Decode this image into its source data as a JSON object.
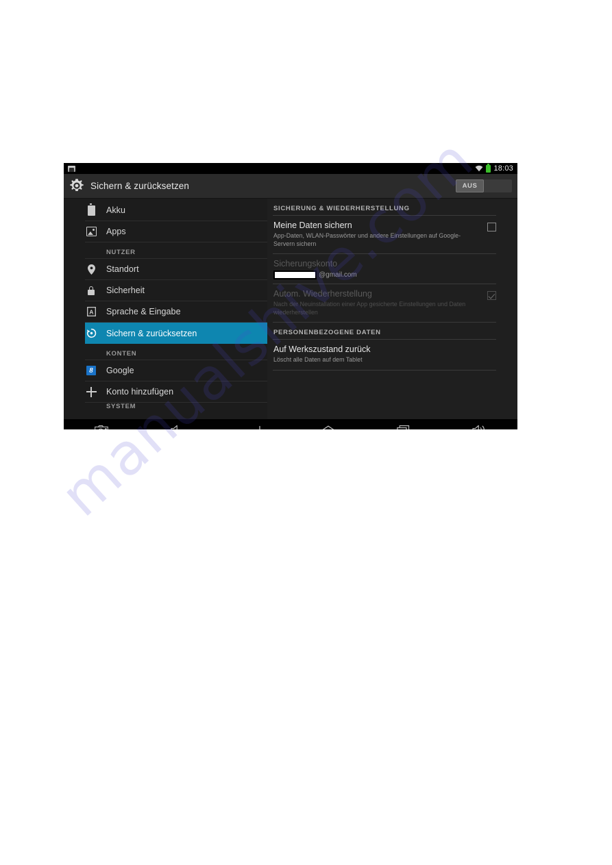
{
  "watermark": {
    "text": "manualshive.com"
  },
  "status_bar": {
    "left_icon": "screenshot-icon",
    "wifi_icon": "wifi-icon",
    "battery_icon": "battery-icon",
    "battery_color": "#3bbf2b",
    "clock": "18:03"
  },
  "action_bar": {
    "icon": "gear-icon",
    "title": "Sichern & zurücksetzen",
    "toggle_label": "AUS"
  },
  "sidebar": {
    "items": [
      {
        "type": "item",
        "label": "Akku",
        "icon": "battery-icon",
        "selected": false
      },
      {
        "type": "item",
        "label": "Apps",
        "icon": "apps-icon",
        "selected": false
      },
      {
        "type": "header",
        "label": "NUTZER"
      },
      {
        "type": "item",
        "label": "Standort",
        "icon": "location-pin-icon",
        "selected": false
      },
      {
        "type": "item",
        "label": "Sicherheit",
        "icon": "lock-icon",
        "selected": false
      },
      {
        "type": "item",
        "label": "Sprache & Eingabe",
        "icon": "language-icon",
        "selected": false
      },
      {
        "type": "item",
        "label": "Sichern & zurücksetzen",
        "icon": "backup-restore-icon",
        "selected": true
      },
      {
        "type": "header",
        "label": "KONTEN"
      },
      {
        "type": "item",
        "label": "Google",
        "icon": "google-icon",
        "selected": false
      },
      {
        "type": "item",
        "label": "Konto hinzufügen",
        "icon": "plus-icon",
        "selected": false
      },
      {
        "type": "header",
        "label": "SYSTEM",
        "cut_off": true
      }
    ],
    "selected_color": "#0e86b0"
  },
  "content": {
    "section_backup": {
      "header": "SICHERUNG & WIEDERHERSTELLUNG",
      "rows": [
        {
          "title": "Meine Daten sichern",
          "subtitle": "App-Daten, WLAN-Passwörter und andere Einstellungen auf Google-Servern sichern",
          "checkbox": "unchecked",
          "disabled": false
        },
        {
          "title": "Sicherungskonto",
          "email_redacted": true,
          "email_domain": "@gmail.com",
          "disabled": true
        },
        {
          "title": "Autom. Wiederherstellung",
          "subtitle": "Nach der Neuinstallation einer App gesicherte Einstellungen und Daten wiederherstellen",
          "checkbox": "checked",
          "disabled": true
        }
      ]
    },
    "section_personal": {
      "header": "PERSONENBEZOGENE DATEN",
      "rows": [
        {
          "title": "Auf Werkszustand zurück",
          "subtitle": "Löscht alle Daten auf dem Tablet",
          "disabled": false
        }
      ]
    }
  },
  "nav_bar": {
    "keys": [
      {
        "name": "screenshot-key",
        "icon": "camera-icon"
      },
      {
        "name": "volume-down-key",
        "icon": "volume-down-icon"
      },
      {
        "name": "back-key",
        "icon": "back-arrow-icon"
      },
      {
        "name": "home-key",
        "icon": "home-icon"
      },
      {
        "name": "recents-key",
        "icon": "recents-icon"
      },
      {
        "name": "volume-up-key",
        "icon": "volume-up-icon"
      }
    ]
  }
}
